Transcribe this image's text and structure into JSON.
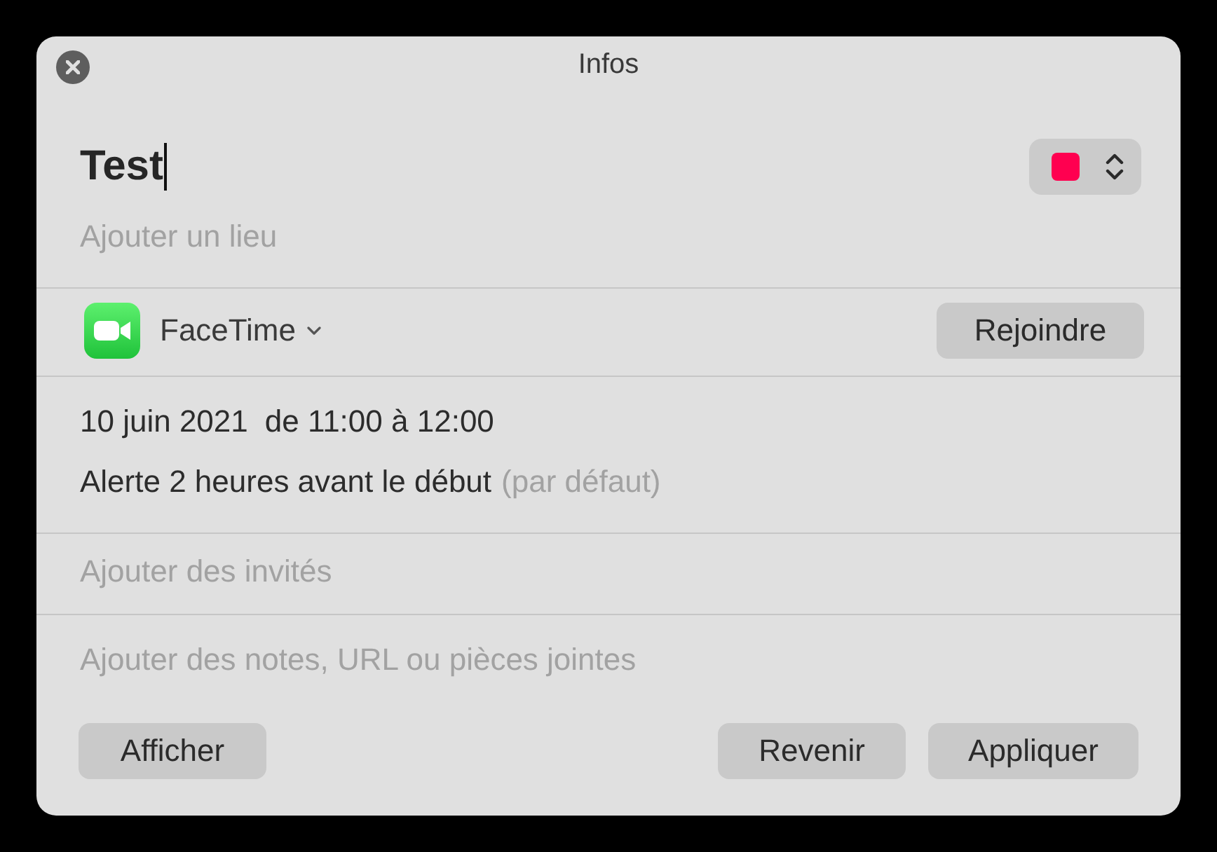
{
  "window": {
    "title": "Infos"
  },
  "event": {
    "title": "Test",
    "focused": true,
    "calendar": {
      "color": "#ff0050"
    },
    "location": {
      "placeholder": "Ajouter un lieu"
    }
  },
  "video_call": {
    "app": "FaceTime",
    "button": "Rejoindre"
  },
  "schedule": {
    "date": "10 juin 2021",
    "time": "de 11:00 à 12:00",
    "alert": "Alerte 2 heures avant le début",
    "alert_note": "(par défaut)"
  },
  "invitees": {
    "placeholder": "Ajouter des invités"
  },
  "notes": {
    "placeholder": "Ajouter des notes, URL ou pièces jointes"
  },
  "footer": {
    "left_buttons": [
      "Afficher"
    ],
    "right_buttons": [
      "Revenir",
      "Appliquer"
    ]
  }
}
